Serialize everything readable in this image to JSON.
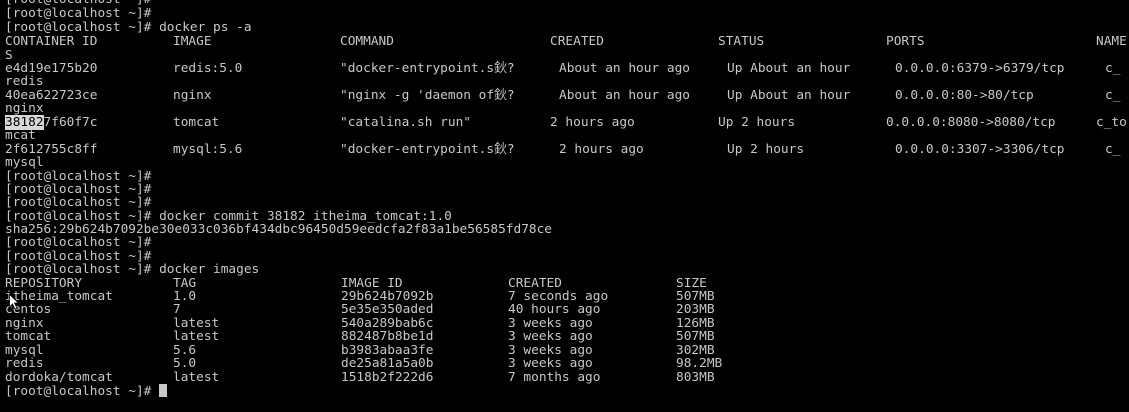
{
  "terminal": {
    "prompt": "[root@localhost ~]#",
    "cmd_ps": "[root@localhost ~]# docker ps -a",
    "ps_headers": [
      "CONTAINER ID",
      "IMAGE",
      "COMMAND",
      "CREATED",
      "STATUS",
      "PORTS",
      "NAME"
    ],
    "ps_header_wrap": "S",
    "ps_rows": [
      {
        "id": "e4d19e175b20",
        "image": "redis:5.0",
        "command": "\"docker-entrypoint.s鈥?",
        "created": "About an hour ago",
        "status": "Up About an hour",
        "ports": "0.0.0.0:6379->6379/tcp",
        "name": "c_",
        "wrap": "redis"
      },
      {
        "id": "40ea622723ce",
        "image": "nginx",
        "command": "\"nginx -g 'daemon of鈥?",
        "created": "About an hour ago",
        "status": "Up About an hour",
        "ports": "0.0.0.0:80->80/tcp",
        "name": "c_",
        "wrap": "nginx"
      },
      {
        "id_sel": "38182",
        "id_rest": "7f60f7c",
        "image": "tomcat",
        "command": "\"catalina.sh run\"",
        "created": "2 hours ago",
        "status": "Up 2 hours",
        "ports": "0.0.0.0:8080->8080/tcp",
        "name": "c_to",
        "wrap": "mcat"
      },
      {
        "id": "2f612755c8ff",
        "image": "mysql:5.6",
        "command": "\"docker-entrypoint.s鈥?",
        "created": "2 hours ago",
        "status": "Up 2 hours",
        "ports": "0.0.0.0:3307->3306/tcp",
        "name": "c_",
        "wrap": "mysql"
      }
    ],
    "cmd_commit": "[root@localhost ~]# docker commit 38182 itheima_tomcat:1.0",
    "commit_hash": "sha256:29b624b7092be30e033c036bf434dbc96450d59eedcfa2f83a1be56585fd78ce",
    "cmd_images": "[root@localhost ~]# docker images",
    "img_headers": [
      "REPOSITORY",
      "TAG",
      "IMAGE ID",
      "CREATED",
      "SIZE"
    ],
    "img_rows": [
      {
        "repo": "itheima_tomcat",
        "tag": "1.0",
        "id": "29b624b7092b",
        "created": "7 seconds ago",
        "size": "507MB"
      },
      {
        "repo": "centos",
        "tag": "7",
        "id": "5e35e350aded",
        "created": "40 hours ago",
        "size": "203MB"
      },
      {
        "repo": "nginx",
        "tag": "latest",
        "id": "540a289bab6c",
        "created": "3 weeks ago",
        "size": "126MB"
      },
      {
        "repo": "tomcat",
        "tag": "latest",
        "id": "882487b8be1d",
        "created": "3 weeks ago",
        "size": "507MB"
      },
      {
        "repo": "mysql",
        "tag": "5.6",
        "id": "b3983abaa3fe",
        "created": "3 weeks ago",
        "size": "302MB"
      },
      {
        "repo": "redis",
        "tag": "5.0",
        "id": "de25a81a5a0b",
        "created": "3 weeks ago",
        "size": "98.2MB"
      },
      {
        "repo": "dordoka/tomcat",
        "tag": "latest",
        "id": "1518b2f222d6",
        "created": "7 months ago",
        "size": "803MB"
      }
    ]
  },
  "colors": {
    "background": "#000000",
    "text": "#c8c8c8",
    "selection": "#d8d8d8"
  },
  "icons": {
    "mouse_pointer": "arrow-cursor-icon"
  }
}
